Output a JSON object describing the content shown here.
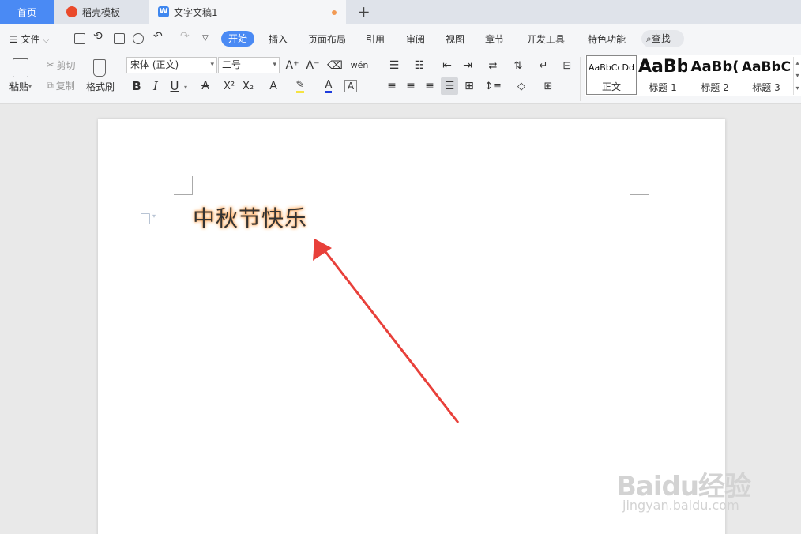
{
  "tabs": {
    "home": "首页",
    "templates": "稻壳模板",
    "document": "文字文稿1",
    "add": "+"
  },
  "menu": {
    "file": "文件",
    "items": [
      "开始",
      "插入",
      "页面布局",
      "引用",
      "审阅",
      "视图",
      "章节",
      "开发工具",
      "特色功能"
    ],
    "search": "查找"
  },
  "ribbon": {
    "paste": "粘贴",
    "cut": "剪切",
    "copy": "复制",
    "format_painter": "格式刷",
    "font_name": "宋体 (正文)",
    "font_size": "二号",
    "bold": "B",
    "italic": "I",
    "underline": "U",
    "styles": [
      {
        "sample": "AaBbCcDd",
        "name": "正文"
      },
      {
        "sample": "AaBb",
        "name": "标题 1"
      },
      {
        "sample": "AaBb(",
        "name": "标题 2"
      },
      {
        "sample": "AaBbC",
        "name": "标题 3"
      }
    ]
  },
  "document": {
    "text": "中秋节快乐"
  },
  "annotation": {
    "arrow_color": "#e8403a"
  },
  "watermark": {
    "logo": "Baidu经验",
    "sub": "jingyan.baidu.com"
  },
  "colors": {
    "accent": "#4a8af4",
    "glow": "#ffa85a"
  }
}
